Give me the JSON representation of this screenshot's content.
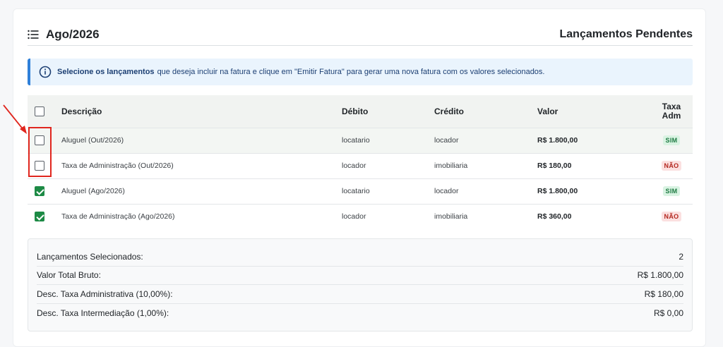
{
  "header": {
    "period": "Ago/2026",
    "title": "Lançamentos Pendentes"
  },
  "alert": {
    "bold_text": "Selecione os lançamentos",
    "text": "que deseja incluir na fatura e clique em \"Emitir Fatura\" para gerar uma nova fatura com os valores selecionados."
  },
  "table": {
    "headers": {
      "descricao": "Descrição",
      "debito": "Débito",
      "credito": "Crédito",
      "valor": "Valor",
      "taxa_line1": "Taxa",
      "taxa_line2": "Adm"
    },
    "rows": [
      {
        "descricao": "Aluguel (Out/2026)",
        "debito": "locatario",
        "credito": "locador",
        "valor": "R$ 1.800,00",
        "taxa": "SIM",
        "checked": false
      },
      {
        "descricao": "Taxa de Administração (Out/2026)",
        "debito": "locador",
        "credito": "imobiliaria",
        "valor": "R$ 180,00",
        "taxa": "NÃO",
        "checked": false
      },
      {
        "descricao": "Aluguel (Ago/2026)",
        "debito": "locatario",
        "credito": "locador",
        "valor": "R$ 1.800,00",
        "taxa": "SIM",
        "checked": true
      },
      {
        "descricao": "Taxa de Administração (Ago/2026)",
        "debito": "locador",
        "credito": "imobiliaria",
        "valor": "R$ 360,00",
        "taxa": "NÃO",
        "checked": true
      }
    ]
  },
  "summary": {
    "rows": [
      {
        "label": "Lançamentos Selecionados:",
        "value": "2"
      },
      {
        "label": "Valor Total Bruto:",
        "value": "R$ 1.800,00"
      },
      {
        "label": "Desc. Taxa Administrativa (10,00%):",
        "value": "R$ 180,00"
      },
      {
        "label": "Desc. Taxa Intermediação (1,00%):",
        "value": "R$ 0,00"
      }
    ]
  },
  "colors": {
    "accent": "#2f80d9",
    "checked": "#1d8a45",
    "annotation": "#e0261e"
  },
  "icons": {
    "header": "list-icon",
    "alert": "info-icon"
  }
}
